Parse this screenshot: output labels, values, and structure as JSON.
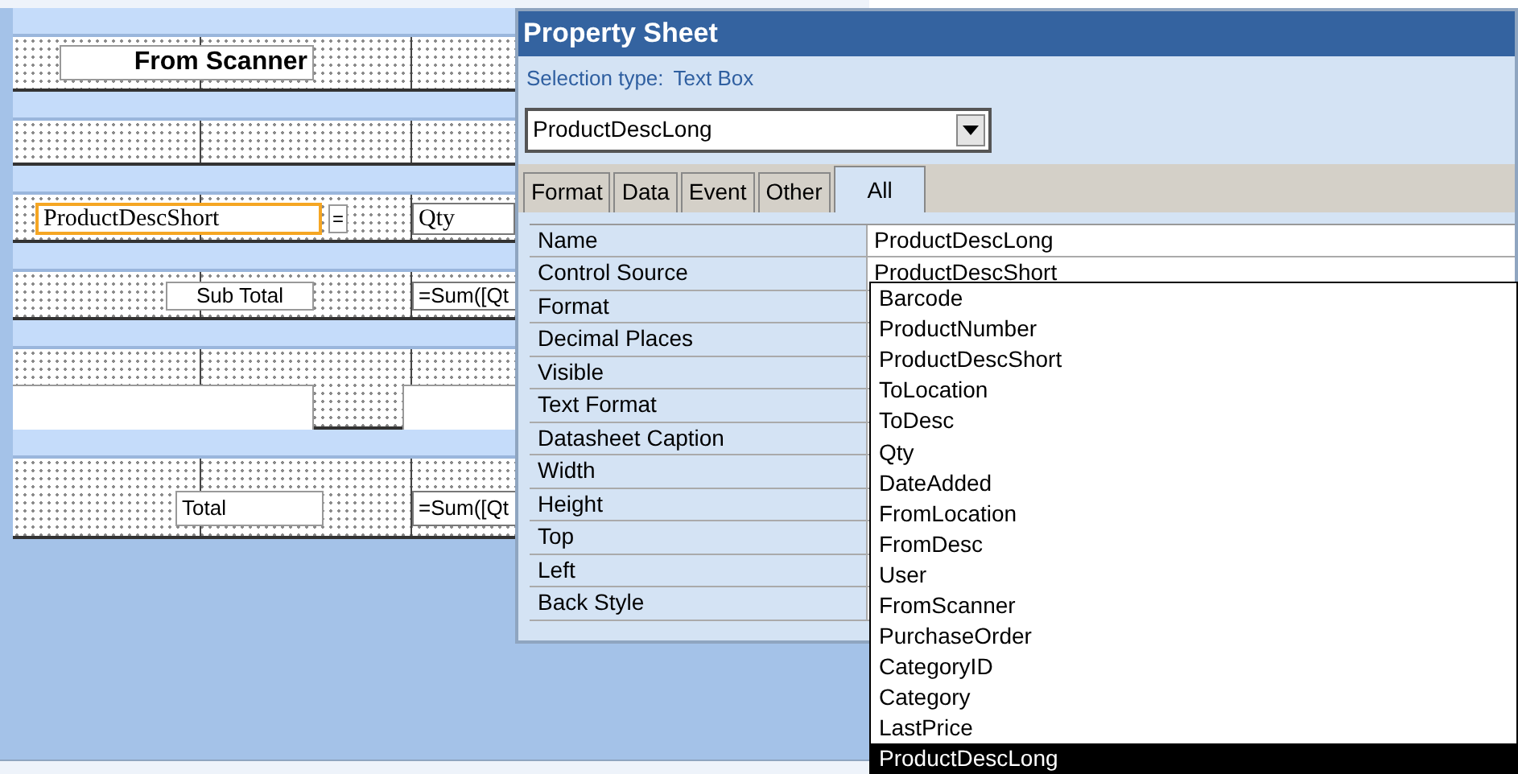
{
  "report_design": {
    "sections": [
      {
        "kind": "page_header",
        "controls": [
          {
            "kind": "label",
            "text": "From Scanner",
            "selected": false
          }
        ]
      },
      {
        "kind": "detail",
        "controls": [
          {
            "kind": "textbox",
            "text": "ProductDescShort",
            "selected": true
          },
          {
            "kind": "label",
            "text": "=",
            "selected": false
          },
          {
            "kind": "textbox",
            "text": "Qty",
            "selected": false
          }
        ]
      },
      {
        "kind": "group_footer",
        "controls": [
          {
            "kind": "label",
            "text": "Sub Total",
            "selected": false
          },
          {
            "kind": "textbox",
            "text": "=Sum([Qt",
            "selected": false
          }
        ]
      },
      {
        "kind": "report_footer",
        "controls": [
          {
            "kind": "label",
            "text": "Total",
            "selected": false
          },
          {
            "kind": "textbox",
            "text": "=Sum([Qt",
            "selected": false
          }
        ]
      }
    ]
  },
  "property_sheet": {
    "title": "Property Sheet",
    "selection_type_label": "Selection type:",
    "selection_type": "Text Box",
    "object_combo": {
      "value": "ProductDescLong"
    },
    "tabs": [
      {
        "label": "Format",
        "selected": false
      },
      {
        "label": "Data",
        "selected": false
      },
      {
        "label": "Event",
        "selected": false
      },
      {
        "label": "Other",
        "selected": false
      },
      {
        "label": "All",
        "selected": true
      }
    ],
    "properties": [
      {
        "name": "Name",
        "value": "ProductDescLong"
      },
      {
        "name": "Control Source",
        "value": "ProductDescShort"
      },
      {
        "name": "Format"
      },
      {
        "name": "Decimal Places"
      },
      {
        "name": "Visible"
      },
      {
        "name": "Text Format"
      },
      {
        "name": "Datasheet Caption"
      },
      {
        "name": "Width"
      },
      {
        "name": "Height"
      },
      {
        "name": "Top"
      },
      {
        "name": "Left"
      },
      {
        "name": "Back Style"
      }
    ],
    "dropdown_list": {
      "items": [
        {
          "label": "Barcode",
          "selected": false
        },
        {
          "label": "ProductNumber",
          "selected": false
        },
        {
          "label": "ProductDescShort",
          "selected": false
        },
        {
          "label": "ToLocation",
          "selected": false
        },
        {
          "label": "ToDesc",
          "selected": false
        },
        {
          "label": "Qty",
          "selected": false
        },
        {
          "label": "DateAdded",
          "selected": false
        },
        {
          "label": "FromLocation",
          "selected": false
        },
        {
          "label": "FromDesc",
          "selected": false
        },
        {
          "label": "User",
          "selected": false
        },
        {
          "label": "FromScanner",
          "selected": false
        },
        {
          "label": "PurchaseOrder",
          "selected": false
        },
        {
          "label": "CategoryID",
          "selected": false
        },
        {
          "label": "Category",
          "selected": false
        },
        {
          "label": "LastPrice",
          "selected": false
        },
        {
          "label": "ProductDescLong",
          "selected": true
        }
      ]
    }
  }
}
